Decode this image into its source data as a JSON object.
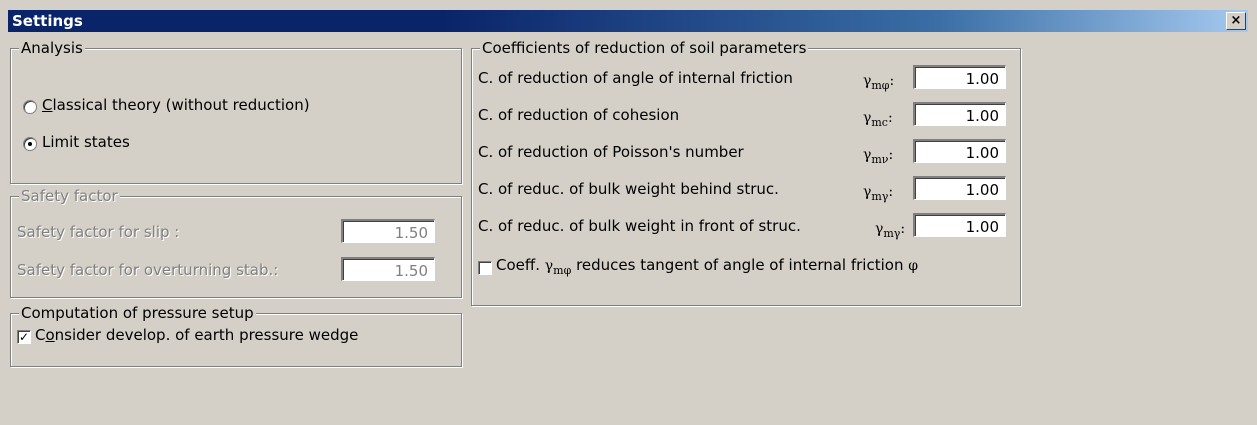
{
  "window": {
    "title": "Settings",
    "close_label": "×"
  },
  "analysis": {
    "legend": "Analysis",
    "option1_prefix": "C",
    "option1_rest": "lassical theory (without reduction)",
    "option2": "Limit states",
    "selected": "limit-states"
  },
  "safety": {
    "legend": "Safety factor",
    "slip_label": "Safety factor for slip   :",
    "slip_value": "1.50",
    "overturning_label": "Safety factor for overturning stab.:",
    "overturning_value": "1.50"
  },
  "pressure": {
    "legend": "Computation of pressure setup",
    "check_prefix": "C",
    "check_underlined": "o",
    "check_rest": "nsider develop. of earth pressure wedge",
    "checked": true
  },
  "coefficients": {
    "legend": "Coefficients of reduction of soil parameters",
    "rows": [
      {
        "label": "C. of reduction of angle of internal friction",
        "symbol": "γ",
        "sub": "mφ",
        "suffix": ":",
        "value": "1.00"
      },
      {
        "label": "C. of reduction of cohesion",
        "symbol": "γ",
        "sub": "mc",
        "suffix": ":",
        "value": "1.00"
      },
      {
        "label": "C. of reduction of  Poisson's number",
        "symbol": "γ",
        "sub": "mν",
        "suffix": ":",
        "value": "1.00"
      },
      {
        "label": "C. of reduc. of bulk weight behind struc.",
        "symbol": "γ",
        "sub": "mγ",
        "suffix": ":",
        "value": "1.00"
      },
      {
        "label": "C. of reduc. of bulk weight in front of struc.",
        "symbol": "γ",
        "sub": "mγ",
        "suffix": ":",
        "value": "1.00"
      }
    ],
    "check_text_a": "Coeff.",
    "check_symbol": "γ",
    "check_sub": "mφ",
    "check_text_b": "reduces tangent of angle of internal friction",
    "check_phi": "φ",
    "checked": false
  }
}
